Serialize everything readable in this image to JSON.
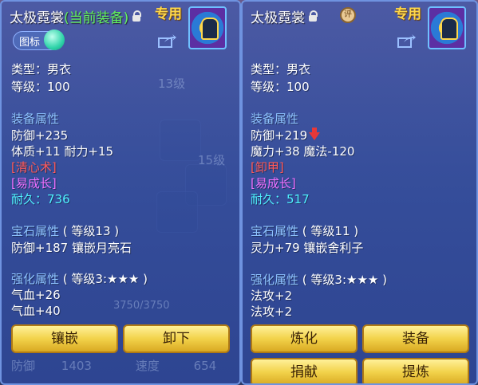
{
  "left": {
    "title": "太极霓裳",
    "current": "(当前装备)",
    "exclusive": "专用",
    "tag_label": "图标",
    "type_line": "类型：男衣",
    "level_line": "等级：100",
    "equip_attr_title": "装备属性",
    "defense": "防御+235",
    "stats": "体质+11 耐力+15",
    "skill": "[清心术]",
    "growth": "[易成长]",
    "durability_label": "耐久：",
    "durability_value": "736",
    "gem_title": "宝石属性",
    "gem_level": "( 等级13 )",
    "gem_line": "防御+187 镶嵌月亮石",
    "enhance_title": "强化属性",
    "enhance_level": "( 等级3:★★★ )",
    "enh1": "气血+26",
    "enh2": "气血+40",
    "btn_inlay": "镶嵌",
    "btn_unequip": "卸下",
    "bottom_left": "防御",
    "bottom_val": "1403",
    "bottom_speed": "速度",
    "bottom_speed_val": "654"
  },
  "right": {
    "title": "太极霓裳",
    "exclusive": "专用",
    "seal": "评",
    "type_line": "类型：男衣",
    "level_line": "等级：100",
    "equip_attr_title": "装备属性",
    "defense": "防御+219",
    "stats": "魔力+38 魔法-120",
    "skill": "[卸甲]",
    "growth": "[易成长]",
    "durability_label": "耐久：",
    "durability_value": "517",
    "gem_title": "宝石属性",
    "gem_level": "( 等级11 )",
    "gem_line": "灵力+79 镶嵌舍利子",
    "enhance_title": "强化属性",
    "enhance_level": "( 等级3:★★★ )",
    "enh1": "法攻+2",
    "enh2": "法攻+2",
    "btn_refine": "炼化",
    "btn_equip": "装备",
    "btn_donate": "捐献",
    "btn_extract": "提炼"
  },
  "background": {
    "hp": "3750/3750",
    "lv13": "13级",
    "lv15": "15级"
  }
}
